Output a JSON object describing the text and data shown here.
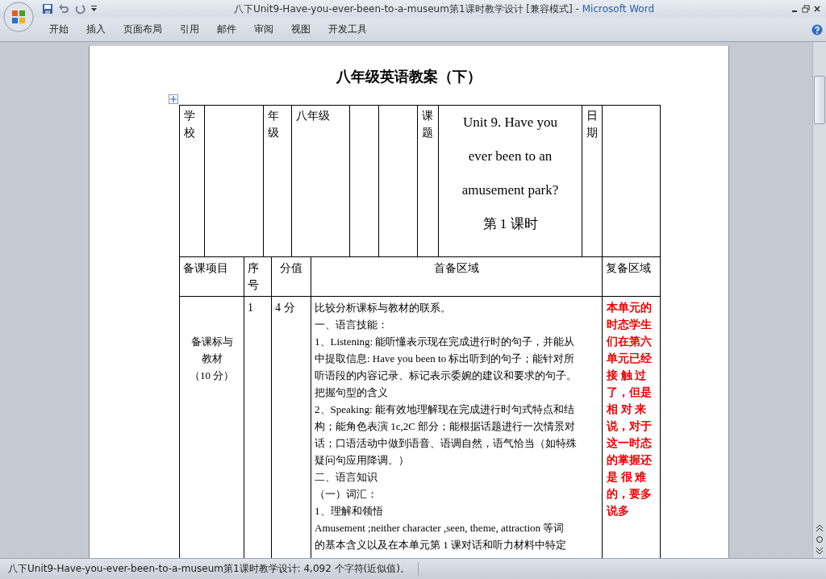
{
  "window": {
    "title": "八下Unit9-Have-you-ever-been-to-a-museum第1课时教学设计 [兼容模式]",
    "separator": "-",
    "app_name": "Microsoft Word"
  },
  "ribbon_tabs": [
    "开始",
    "插入",
    "页面布局",
    "引用",
    "邮件",
    "审阅",
    "视图",
    "开发工具"
  ],
  "document": {
    "heading": "八年级英语教案（下）",
    "top_row": [
      {
        "kind": "stack",
        "text": "学校"
      },
      {
        "kind": "empty"
      },
      {
        "kind": "stack",
        "text": "年级"
      },
      {
        "kind": "value",
        "text": "八年级"
      },
      {
        "kind": "empty"
      },
      {
        "kind": "empty"
      },
      {
        "kind": "stack",
        "text": "课题"
      },
      {
        "kind": "title",
        "lines": [
          "Unit 9. Have you",
          "ever been to an",
          "amusement park?",
          "第 1 课时"
        ]
      },
      {
        "kind": "stack",
        "text": "日期"
      },
      {
        "kind": "empty"
      }
    ],
    "column_headings": [
      {
        "kind": "value",
        "text": "备课项目"
      },
      {
        "kind": "stack",
        "text": "序号"
      },
      {
        "kind": "center",
        "text": "分值"
      },
      {
        "kind": "center",
        "text": "首备区域"
      },
      {
        "kind": "value",
        "text": "复备区域"
      }
    ],
    "row": {
      "section": [
        "备课标与",
        "教材",
        "（10 分）"
      ],
      "number": "1",
      "score": "4 分",
      "content": [
        "比较分析课标与教材的联系。",
        "一、语言技能：",
        "1、Listening: 能听懂表示现在完成进行时的句子，并能从",
        "中提取信息: Have you been to 标出听到的句子；能针对所",
        "听语段的内容记录、标记表示委婉的建议和要求的句子。",
        "把握句型的含义",
        "2、Speaking: 能有效地理解现在完成进行时句式特点和结",
        "构；能角色表演 1c,2C 部分；能根据话题进行一次情景对",
        "话；口语活动中做到语音、语调自然，语气恰当（如特殊",
        "疑问句应用降调。）",
        "二、语言知识",
        "（一）词汇：",
        "1、理解和领悟",
        "Amusement ;neither  character ,seen, theme, attraction 等词",
        "的基本含义以及在本单元第 1 课对话和听力材料中特定"
      ],
      "review": [
        "本单元的",
        "时态学生",
        "们在第六",
        "单元已经",
        "接 触 过",
        "了，但是",
        "相 对 来",
        "说，对于",
        "这一时态",
        "的掌握还",
        "是 很 难",
        "的，要多",
        "说多"
      ]
    }
  },
  "status_bar": {
    "text": "八下Unit9-Have-you-ever-been-to-a-museum第1课时教学设计: 4,092 个字符(近似值)。"
  }
}
